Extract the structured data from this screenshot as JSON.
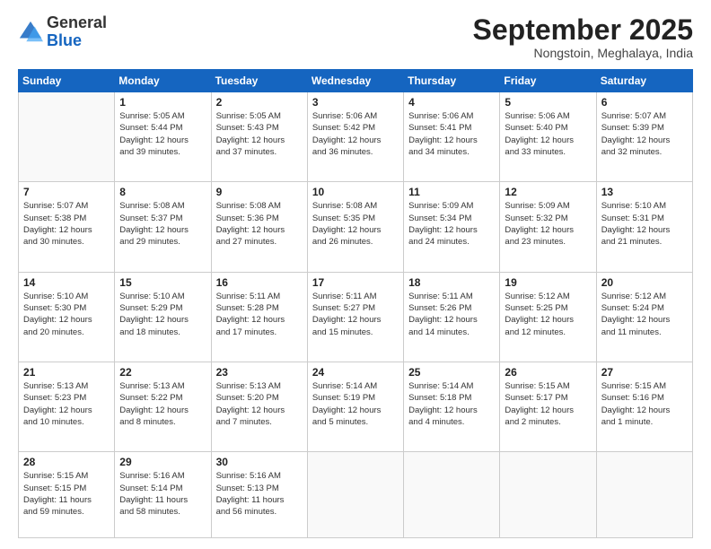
{
  "header": {
    "logo_general": "General",
    "logo_blue": "Blue",
    "month_title": "September 2025",
    "subtitle": "Nongstoin, Meghalaya, India"
  },
  "days_of_week": [
    "Sunday",
    "Monday",
    "Tuesday",
    "Wednesday",
    "Thursday",
    "Friday",
    "Saturday"
  ],
  "weeks": [
    [
      {
        "day": "",
        "info": ""
      },
      {
        "day": "1",
        "info": "Sunrise: 5:05 AM\nSunset: 5:44 PM\nDaylight: 12 hours\nand 39 minutes."
      },
      {
        "day": "2",
        "info": "Sunrise: 5:05 AM\nSunset: 5:43 PM\nDaylight: 12 hours\nand 37 minutes."
      },
      {
        "day": "3",
        "info": "Sunrise: 5:06 AM\nSunset: 5:42 PM\nDaylight: 12 hours\nand 36 minutes."
      },
      {
        "day": "4",
        "info": "Sunrise: 5:06 AM\nSunset: 5:41 PM\nDaylight: 12 hours\nand 34 minutes."
      },
      {
        "day": "5",
        "info": "Sunrise: 5:06 AM\nSunset: 5:40 PM\nDaylight: 12 hours\nand 33 minutes."
      },
      {
        "day": "6",
        "info": "Sunrise: 5:07 AM\nSunset: 5:39 PM\nDaylight: 12 hours\nand 32 minutes."
      }
    ],
    [
      {
        "day": "7",
        "info": "Sunrise: 5:07 AM\nSunset: 5:38 PM\nDaylight: 12 hours\nand 30 minutes."
      },
      {
        "day": "8",
        "info": "Sunrise: 5:08 AM\nSunset: 5:37 PM\nDaylight: 12 hours\nand 29 minutes."
      },
      {
        "day": "9",
        "info": "Sunrise: 5:08 AM\nSunset: 5:36 PM\nDaylight: 12 hours\nand 27 minutes."
      },
      {
        "day": "10",
        "info": "Sunrise: 5:08 AM\nSunset: 5:35 PM\nDaylight: 12 hours\nand 26 minutes."
      },
      {
        "day": "11",
        "info": "Sunrise: 5:09 AM\nSunset: 5:34 PM\nDaylight: 12 hours\nand 24 minutes."
      },
      {
        "day": "12",
        "info": "Sunrise: 5:09 AM\nSunset: 5:32 PM\nDaylight: 12 hours\nand 23 minutes."
      },
      {
        "day": "13",
        "info": "Sunrise: 5:10 AM\nSunset: 5:31 PM\nDaylight: 12 hours\nand 21 minutes."
      }
    ],
    [
      {
        "day": "14",
        "info": "Sunrise: 5:10 AM\nSunset: 5:30 PM\nDaylight: 12 hours\nand 20 minutes."
      },
      {
        "day": "15",
        "info": "Sunrise: 5:10 AM\nSunset: 5:29 PM\nDaylight: 12 hours\nand 18 minutes."
      },
      {
        "day": "16",
        "info": "Sunrise: 5:11 AM\nSunset: 5:28 PM\nDaylight: 12 hours\nand 17 minutes."
      },
      {
        "day": "17",
        "info": "Sunrise: 5:11 AM\nSunset: 5:27 PM\nDaylight: 12 hours\nand 15 minutes."
      },
      {
        "day": "18",
        "info": "Sunrise: 5:11 AM\nSunset: 5:26 PM\nDaylight: 12 hours\nand 14 minutes."
      },
      {
        "day": "19",
        "info": "Sunrise: 5:12 AM\nSunset: 5:25 PM\nDaylight: 12 hours\nand 12 minutes."
      },
      {
        "day": "20",
        "info": "Sunrise: 5:12 AM\nSunset: 5:24 PM\nDaylight: 12 hours\nand 11 minutes."
      }
    ],
    [
      {
        "day": "21",
        "info": "Sunrise: 5:13 AM\nSunset: 5:23 PM\nDaylight: 12 hours\nand 10 minutes."
      },
      {
        "day": "22",
        "info": "Sunrise: 5:13 AM\nSunset: 5:22 PM\nDaylight: 12 hours\nand 8 minutes."
      },
      {
        "day": "23",
        "info": "Sunrise: 5:13 AM\nSunset: 5:20 PM\nDaylight: 12 hours\nand 7 minutes."
      },
      {
        "day": "24",
        "info": "Sunrise: 5:14 AM\nSunset: 5:19 PM\nDaylight: 12 hours\nand 5 minutes."
      },
      {
        "day": "25",
        "info": "Sunrise: 5:14 AM\nSunset: 5:18 PM\nDaylight: 12 hours\nand 4 minutes."
      },
      {
        "day": "26",
        "info": "Sunrise: 5:15 AM\nSunset: 5:17 PM\nDaylight: 12 hours\nand 2 minutes."
      },
      {
        "day": "27",
        "info": "Sunrise: 5:15 AM\nSunset: 5:16 PM\nDaylight: 12 hours\nand 1 minute."
      }
    ],
    [
      {
        "day": "28",
        "info": "Sunrise: 5:15 AM\nSunset: 5:15 PM\nDaylight: 11 hours\nand 59 minutes."
      },
      {
        "day": "29",
        "info": "Sunrise: 5:16 AM\nSunset: 5:14 PM\nDaylight: 11 hours\nand 58 minutes."
      },
      {
        "day": "30",
        "info": "Sunrise: 5:16 AM\nSunset: 5:13 PM\nDaylight: 11 hours\nand 56 minutes."
      },
      {
        "day": "",
        "info": ""
      },
      {
        "day": "",
        "info": ""
      },
      {
        "day": "",
        "info": ""
      },
      {
        "day": "",
        "info": ""
      }
    ]
  ]
}
